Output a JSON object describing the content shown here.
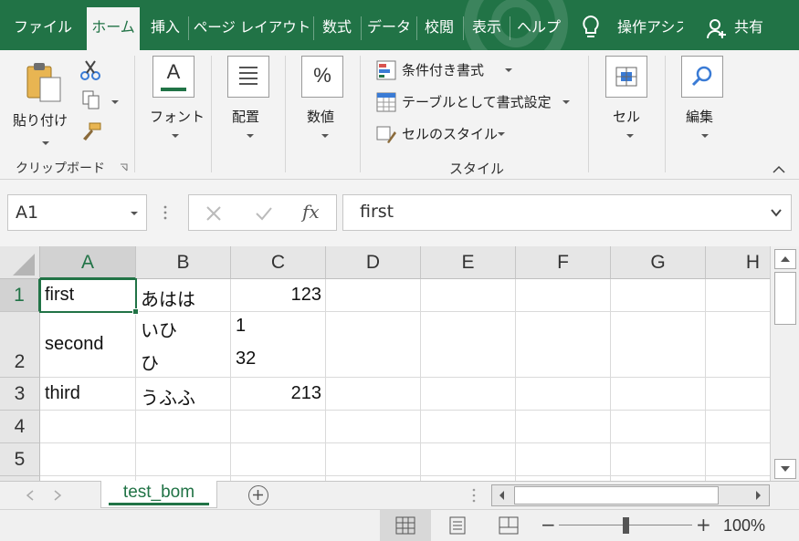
{
  "ribbon_tabs": [
    {
      "label": "ファイル",
      "active": false
    },
    {
      "label": "ホーム",
      "active": true
    },
    {
      "label": "挿入",
      "active": false
    },
    {
      "label": "ページ レイアウト",
      "active": false
    },
    {
      "label": "数式",
      "active": false
    },
    {
      "label": "データ",
      "active": false
    },
    {
      "label": "校閲",
      "active": false
    },
    {
      "label": "表示",
      "active": false
    },
    {
      "label": "ヘルプ",
      "active": false
    }
  ],
  "tell_me": {
    "icon": "lightbulb-icon",
    "label": "操作アシスト"
  },
  "share": {
    "icon": "person-add-icon",
    "label": "共有"
  },
  "clipboard": {
    "paste_label": "貼り付け",
    "group_label": "クリップボード",
    "icons": [
      "paste-icon",
      "scissors-icon",
      "copy-icon",
      "format-painter-icon"
    ]
  },
  "font": {
    "label": "フォント",
    "glyph": "A",
    "icon": "font-icon"
  },
  "alignment": {
    "label": "配置",
    "icon": "align-icon"
  },
  "number": {
    "label": "数値",
    "glyph": "%",
    "icon": "percent-icon"
  },
  "styles": {
    "items": [
      {
        "label": "条件付き書式",
        "icon": "conditional-format-icon"
      },
      {
        "label": "テーブルとして書式設定",
        "icon": "format-as-table-icon"
      },
      {
        "label": "セルのスタイル",
        "icon": "cell-styles-icon"
      }
    ],
    "group_label": "スタイル"
  },
  "cells": {
    "label": "セル",
    "icon": "cells-icon"
  },
  "editing": {
    "label": "編集",
    "icon": "magnifier-icon"
  },
  "formula_bar": {
    "name_box": "A1",
    "content": "first",
    "fx_label": "fx"
  },
  "columns": [
    "A",
    "B",
    "C",
    "D",
    "E",
    "F",
    "G",
    "H"
  ],
  "selected_column": "A",
  "rows": [
    {
      "num": "1",
      "a": "first",
      "b": "あはは",
      "c": "123"
    },
    {
      "num": "2",
      "a": "second",
      "b1": "いひ",
      "b2": "ひ",
      "c1": "1",
      "c2": "32"
    },
    {
      "num": "3",
      "a": "third",
      "b": "うふふ",
      "c": "213"
    },
    {
      "num": "4"
    },
    {
      "num": "5"
    }
  ],
  "selected_cell": "A1",
  "sheet_tabs": [
    {
      "name": "test_bom",
      "active": true
    }
  ],
  "status": {
    "zoom": "100%",
    "zoom_minus": "−",
    "zoom_plus": "+",
    "zoom_level_percent": 100
  },
  "colors": {
    "accent": "#217346",
    "ribbon_bg": "#f3f3f3",
    "header_bg": "#e6e6e6"
  }
}
